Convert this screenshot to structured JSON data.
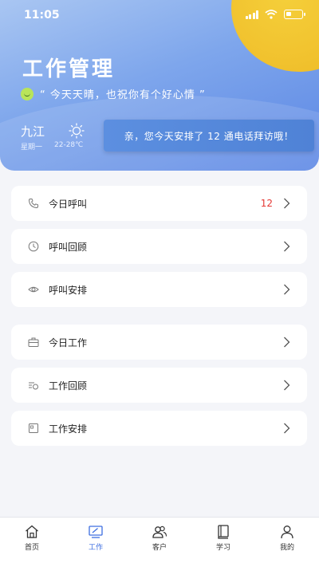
{
  "status_bar": {
    "time": "11:05"
  },
  "header": {
    "title": "工作管理",
    "motto": "“ 今天天晴，也祝你有个好心情 ”",
    "weather": {
      "city": "九江",
      "weekday": "星期一",
      "temp": "22-28℃"
    },
    "notice": "亲，您今天安排了 12 通电话拜访哦！"
  },
  "menu": [
    {
      "label": "今日呼叫",
      "count": "12",
      "icon": "phone-icon"
    },
    {
      "label": "呼叫回顾",
      "count": "",
      "icon": "clock-icon"
    },
    {
      "label": "呼叫安排",
      "count": "",
      "icon": "eye-icon"
    },
    {
      "label": "今日工作",
      "count": "",
      "icon": "briefcase-icon"
    },
    {
      "label": "工作回顾",
      "count": "",
      "icon": "review-icon"
    },
    {
      "label": "工作安排",
      "count": "",
      "icon": "calendar-icon"
    }
  ],
  "tabbar": {
    "items": [
      {
        "label": "首页",
        "icon": "home-icon"
      },
      {
        "label": "工作",
        "icon": "work-icon",
        "active": true
      },
      {
        "label": "客户",
        "icon": "customers-icon"
      },
      {
        "label": "学习",
        "icon": "book-icon"
      },
      {
        "label": "我的",
        "icon": "profile-icon"
      }
    ]
  },
  "colors": {
    "accent": "#3d6ee0",
    "badge": "#e53935",
    "header": "#7ea6ec",
    "sun": "#f1c22e"
  }
}
